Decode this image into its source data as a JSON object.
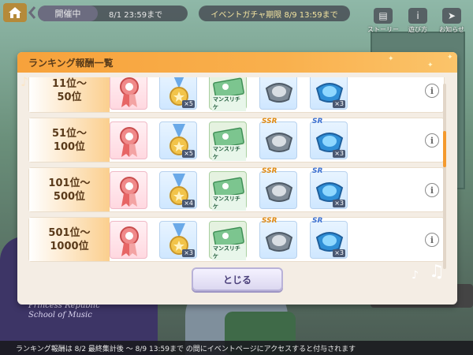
{
  "topbar": {
    "status_tag": "開催中",
    "status_date": "8/1 23:59まで",
    "gacha_period": "イベントガチャ期限 8/9 13:59まで",
    "icons": [
      {
        "name": "story-icon",
        "label": "ストーリー",
        "glyph": "▤"
      },
      {
        "name": "how-to-play-icon",
        "label": "遊び方",
        "glyph": "i"
      },
      {
        "name": "notice-icon",
        "label": "お知らせ",
        "glyph": "➤"
      }
    ]
  },
  "modal": {
    "title": "ランキング報酬一覧",
    "close_label": "とじる",
    "rows": [
      {
        "rank": "11位〜\n50位",
        "medal_qty": "×5",
        "ticket_label": "マンスリチケ",
        "ssr_tag": "",
        "sr_tag": "",
        "sr_qty": "×3"
      },
      {
        "rank": "51位〜\n100位",
        "medal_qty": "×5",
        "ticket_label": "マンスリチケ",
        "ssr_tag": "SSR",
        "sr_tag": "SR",
        "sr_qty": "×3"
      },
      {
        "rank": "101位〜\n500位",
        "medal_qty": "×4",
        "ticket_label": "マンスリチケ",
        "ssr_tag": "SSR",
        "sr_tag": "SR",
        "sr_qty": "×3"
      },
      {
        "rank": "501位〜\n1000位",
        "medal_qty": "×3",
        "ticket_label": "マンスリチケ",
        "ssr_tag": "SSR",
        "sr_tag": "SR",
        "sr_qty": "×3"
      }
    ]
  },
  "background": {
    "school_text_1": "Princess Republic",
    "school_text_2": "School of Music"
  },
  "footer": {
    "text": "ランキング報酬は 8/2 最終集計後 〜 8/9 13:59まで の間にイベントページにアクセスすると付与されます"
  },
  "colors": {
    "header_orange": "#f7a23b",
    "scroll_accent": "#f49a2e",
    "button_purple": "#4a3f7a"
  }
}
